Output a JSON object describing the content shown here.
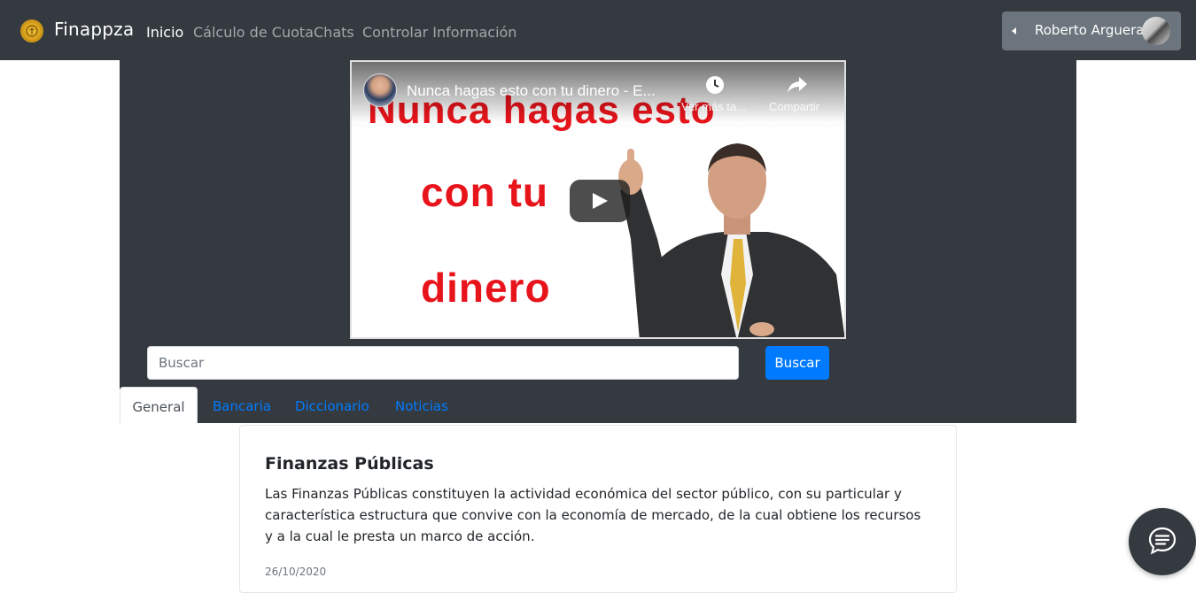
{
  "navbar": {
    "brand": "Finappza",
    "links": [
      {
        "label": "Inicio",
        "active": true
      },
      {
        "label": "Cálculo de Cuota",
        "active": false
      },
      {
        "label": "Chats",
        "active": false
      },
      {
        "label": "Controlar Información",
        "active": false
      }
    ],
    "user": {
      "name": "Roberto Arguera",
      "icon": "caret-left-icon"
    }
  },
  "video": {
    "title": "Nunca hagas esto con tu dinero - E...",
    "overlay_lines": [
      "Nunca hagas esto",
      "con tu",
      "dinero"
    ],
    "watch_later_label": "Ver más ta...",
    "share_label": "Compartir"
  },
  "search": {
    "placeholder": "Buscar",
    "value": "",
    "button_label": "Buscar"
  },
  "tabs": [
    {
      "label": "General",
      "active": true
    },
    {
      "label": "Bancaria",
      "active": false
    },
    {
      "label": "Diccionario",
      "active": false
    },
    {
      "label": "Noticias",
      "active": false
    }
  ],
  "article": {
    "title": "Finanzas Públicas",
    "body": "Las Finanzas Públicas constituyen la actividad económica del sector público, con su particular y característica estructura que convive con la economía de mercado, de la cual obtiene los recursos y a la cual le presta un marco de acción.",
    "date": "26/10/2020"
  },
  "colors": {
    "navbar_bg": "#343a40",
    "primary": "#007bff",
    "user_button_bg": "#6c757d",
    "video_text_red": "#e8141b"
  },
  "icons": {
    "brand": "coin-logo-icon",
    "watch_later": "clock-icon",
    "share": "share-arrow-icon",
    "play": "play-icon",
    "chat": "chat-bubble-icon"
  }
}
